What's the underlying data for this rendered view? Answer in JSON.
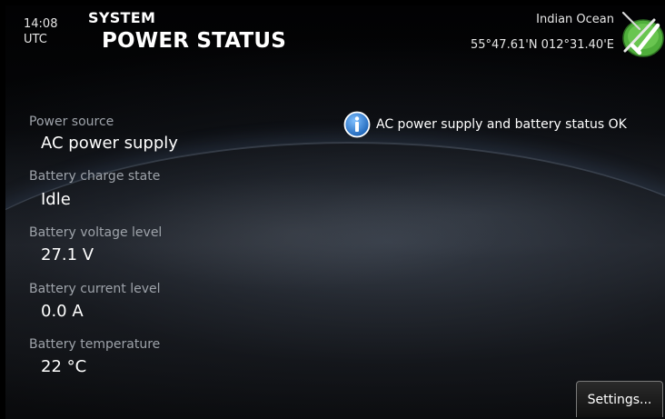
{
  "header": {
    "time": "14:08",
    "timezone": "UTC",
    "section": "SYSTEM",
    "title": "POWER STATUS",
    "location": "Indian Ocean",
    "coordinates": "55°47.61'N  012°31.40'E"
  },
  "status_message": {
    "icon": "info-icon",
    "text": "AC power supply and battery status OK"
  },
  "fields": [
    {
      "label": "Power source",
      "value": "AC power supply"
    },
    {
      "label": "Battery charge state",
      "value": "Idle"
    },
    {
      "label": "Battery voltage level",
      "value": "27.1 V"
    },
    {
      "label": "Battery current level",
      "value": "0.0 A"
    },
    {
      "label": "Battery temperature",
      "value": "22 °C"
    }
  ],
  "buttons": {
    "settings": "Settings..."
  },
  "colors": {
    "info_blue": "#2a7fd4",
    "logo_green": "#4fae3b"
  }
}
